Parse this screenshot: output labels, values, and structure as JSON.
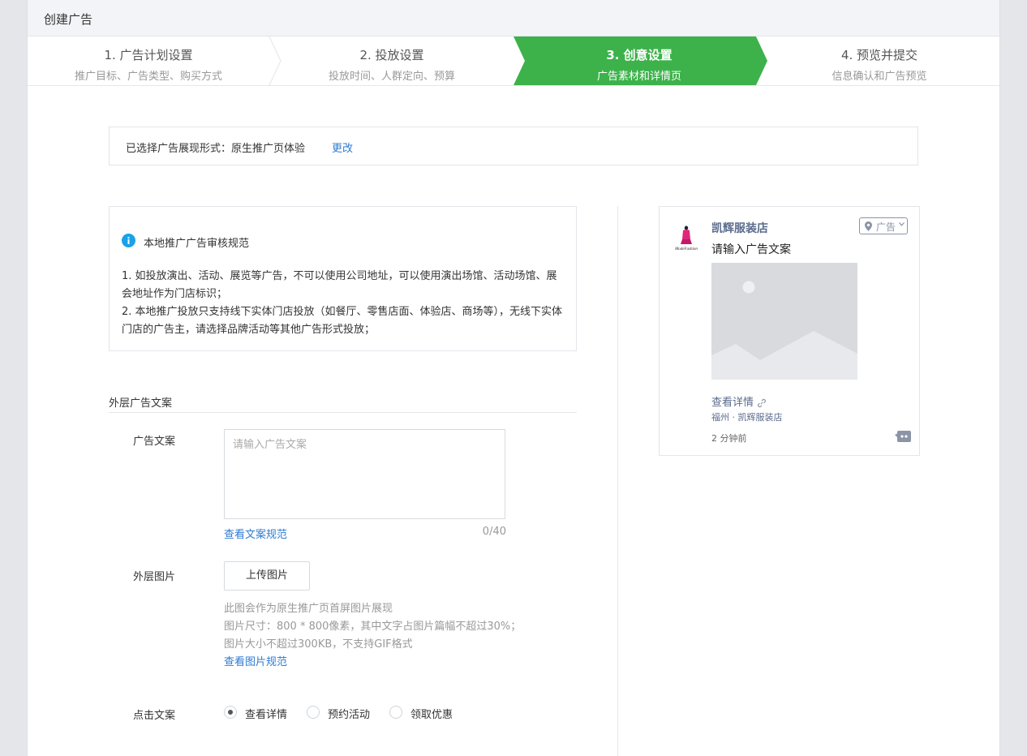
{
  "header": {
    "title": "创建广告"
  },
  "steps": [
    {
      "title": "1. 广告计划设置",
      "subtitle": "推广目标、广告类型、购买方式"
    },
    {
      "title": "2. 投放设置",
      "subtitle": "投放时间、人群定向、预算"
    },
    {
      "title": "3. 创意设置",
      "subtitle": "广告素材和详情页"
    },
    {
      "title": "4. 预览并提交",
      "subtitle": "信息确认和广告预览"
    }
  ],
  "active_step": 3,
  "colors": {
    "accent_green": "#3db24b",
    "link_blue": "#2e7bd1",
    "info_blue": "#1aa1e8"
  },
  "selected_format": {
    "label": "已选择广告展现形式：原生推广页体验",
    "change_link": "更改"
  },
  "notice": {
    "icon": "info-icon",
    "title": "本地推广广告审核规范",
    "rules": [
      "1. 如投放演出、活动、展览等广告，不可以使用公司地址，可以使用演出场馆、活动场馆、展会地址作为门店标识；",
      "2. 本地推广投放只支持线下实体门店投放（如餐厅、零售店面、体验店、商场等），无线下实体门店的广告主，请选择品牌活动等其他广告形式投放；"
    ]
  },
  "section": {
    "title": "外层广告文案"
  },
  "form": {
    "copy_label": "广告文案",
    "copy_placeholder": "请输入广告文案",
    "copy_rule_link": "查看文案规范",
    "copy_counter": "0/40",
    "image_label": "外层图片",
    "upload_button": "上传图片",
    "image_hints": [
      "此图会作为原生推广页首屏图片展现",
      "图片尺寸：800 * 800像素，其中文字占图片篇幅不超过30%；",
      "图片大小不超过300KB，不支持GIF格式"
    ],
    "image_rule_link": "查看图片规范",
    "click_label": "点击文案",
    "click_options": [
      "查看详情",
      "预约活动",
      "领取优惠"
    ],
    "click_selected": "查看详情"
  },
  "preview": {
    "store_name": "凯辉服装店",
    "ad_tag": "广告",
    "copy_text": "请输入广告文案",
    "detail_link": "查看详情",
    "location": "福州 · 凯辉服装店",
    "time": "2 分钟前",
    "avatar_logo_text": "ModeFashion"
  }
}
